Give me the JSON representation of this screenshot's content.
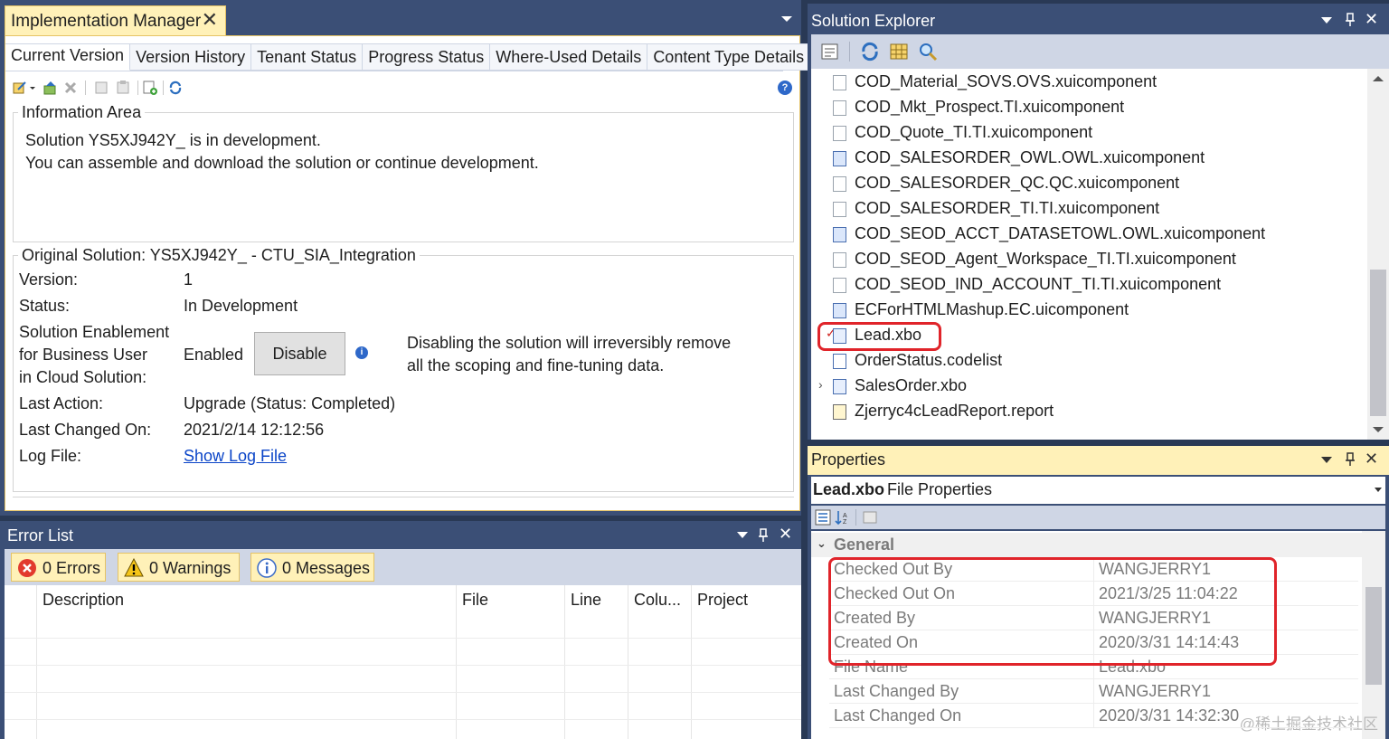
{
  "impl": {
    "title": "Implementation Manager",
    "close_glyph": "✕",
    "tabs": [
      "Current Version",
      "Version History",
      "Tenant Status",
      "Progress Status",
      "Where-Used Details",
      "Content Type Details"
    ],
    "info_area_title": "Information Area",
    "info_line1": "Solution YS5XJ942Y_ is in development.",
    "info_line2": "You can assemble and download the solution or continue development.",
    "original_title": "Original Solution: YS5XJ942Y_ - CTU_SIA_Integration",
    "labels": {
      "version": "Version:",
      "status": "Status:",
      "enable1": "Solution Enablement",
      "enable2": "for Business User",
      "enable3": "in Cloud Solution:",
      "last_action": "Last Action:",
      "last_changed": "Last Changed On:",
      "log_file": "Log File:"
    },
    "values": {
      "version": "1",
      "status": "In Development",
      "enablement": "Enabled",
      "last_action": "Upgrade (Status: Completed)",
      "last_changed": "2021/2/14 12:12:56",
      "log_link": "Show Log File"
    },
    "disable_button": "Disable",
    "info_glyph": "i",
    "help_glyph": "?",
    "disable_note1": "Disabling the solution will irreversibly remove",
    "disable_note2": "all the scoping and fine-tuning data."
  },
  "errors": {
    "title": "Error List",
    "errors_label": "0 Errors",
    "warnings_label": "0 Warnings",
    "messages_label": "0 Messages",
    "columns": [
      "Description",
      "File",
      "Line",
      "Colu...",
      "Project"
    ],
    "pin_glyph": "📌",
    "close_glyph": "✕"
  },
  "solution_explorer": {
    "title": "Solution Explorer",
    "items": [
      {
        "name": "COD_Material_SOVS.OVS.xuicomponent",
        "icon": "document-icon"
      },
      {
        "name": "COD_Mkt_Prospect.TI.xuicomponent",
        "icon": "document-icon"
      },
      {
        "name": "COD_Quote_TI.TI.xuicomponent",
        "icon": "document-icon"
      },
      {
        "name": "COD_SALESORDER_OWL.OWL.xuicomponent",
        "icon": "ui-component-icon"
      },
      {
        "name": "COD_SALESORDER_QC.QC.xuicomponent",
        "icon": "document-icon"
      },
      {
        "name": "COD_SALESORDER_TI.TI.xuicomponent",
        "icon": "document-icon"
      },
      {
        "name": "COD_SEOD_ACCT_DATASETOWL.OWL.xuicomponent",
        "icon": "ui-component-icon"
      },
      {
        "name": "COD_SEOD_Agent_Workspace_TI.TI.xuicomponent",
        "icon": "document-icon"
      },
      {
        "name": "COD_SEOD_IND_ACCOUNT_TI.TI.xuicomponent",
        "icon": "document-icon"
      },
      {
        "name": "ECForHTMLMashup.EC.uicomponent",
        "icon": "ui-component-icon"
      },
      {
        "name": "Lead.xbo",
        "icon": "business-object-icon"
      },
      {
        "name": "OrderStatus.codelist",
        "icon": "code-list-icon"
      },
      {
        "name": "SalesOrder.xbo",
        "icon": "business-object-icon"
      },
      {
        "name": "Zjerryc4cLeadReport.report",
        "icon": "report-icon"
      }
    ],
    "checkmark": "✓",
    "expander": "›"
  },
  "properties": {
    "title": "Properties",
    "object_name": "Lead.xbo",
    "object_type": "File Properties",
    "category": "General",
    "rows": [
      {
        "key": "Checked Out By",
        "value": "WANGJERRY1"
      },
      {
        "key": "Checked Out On",
        "value": "2021/3/25 11:04:22"
      },
      {
        "key": "Created By",
        "value": "WANGJERRY1"
      },
      {
        "key": "Created On",
        "value": "2020/3/31 14:14:43"
      },
      {
        "key": "File Name",
        "value": "Lead.xbo"
      },
      {
        "key": "Last Changed By",
        "value": "WANGJERRY1"
      },
      {
        "key": "Last Changed On",
        "value": "2020/3/31 14:32:30"
      }
    ],
    "watermark": "@稀土掘金技术社区"
  }
}
